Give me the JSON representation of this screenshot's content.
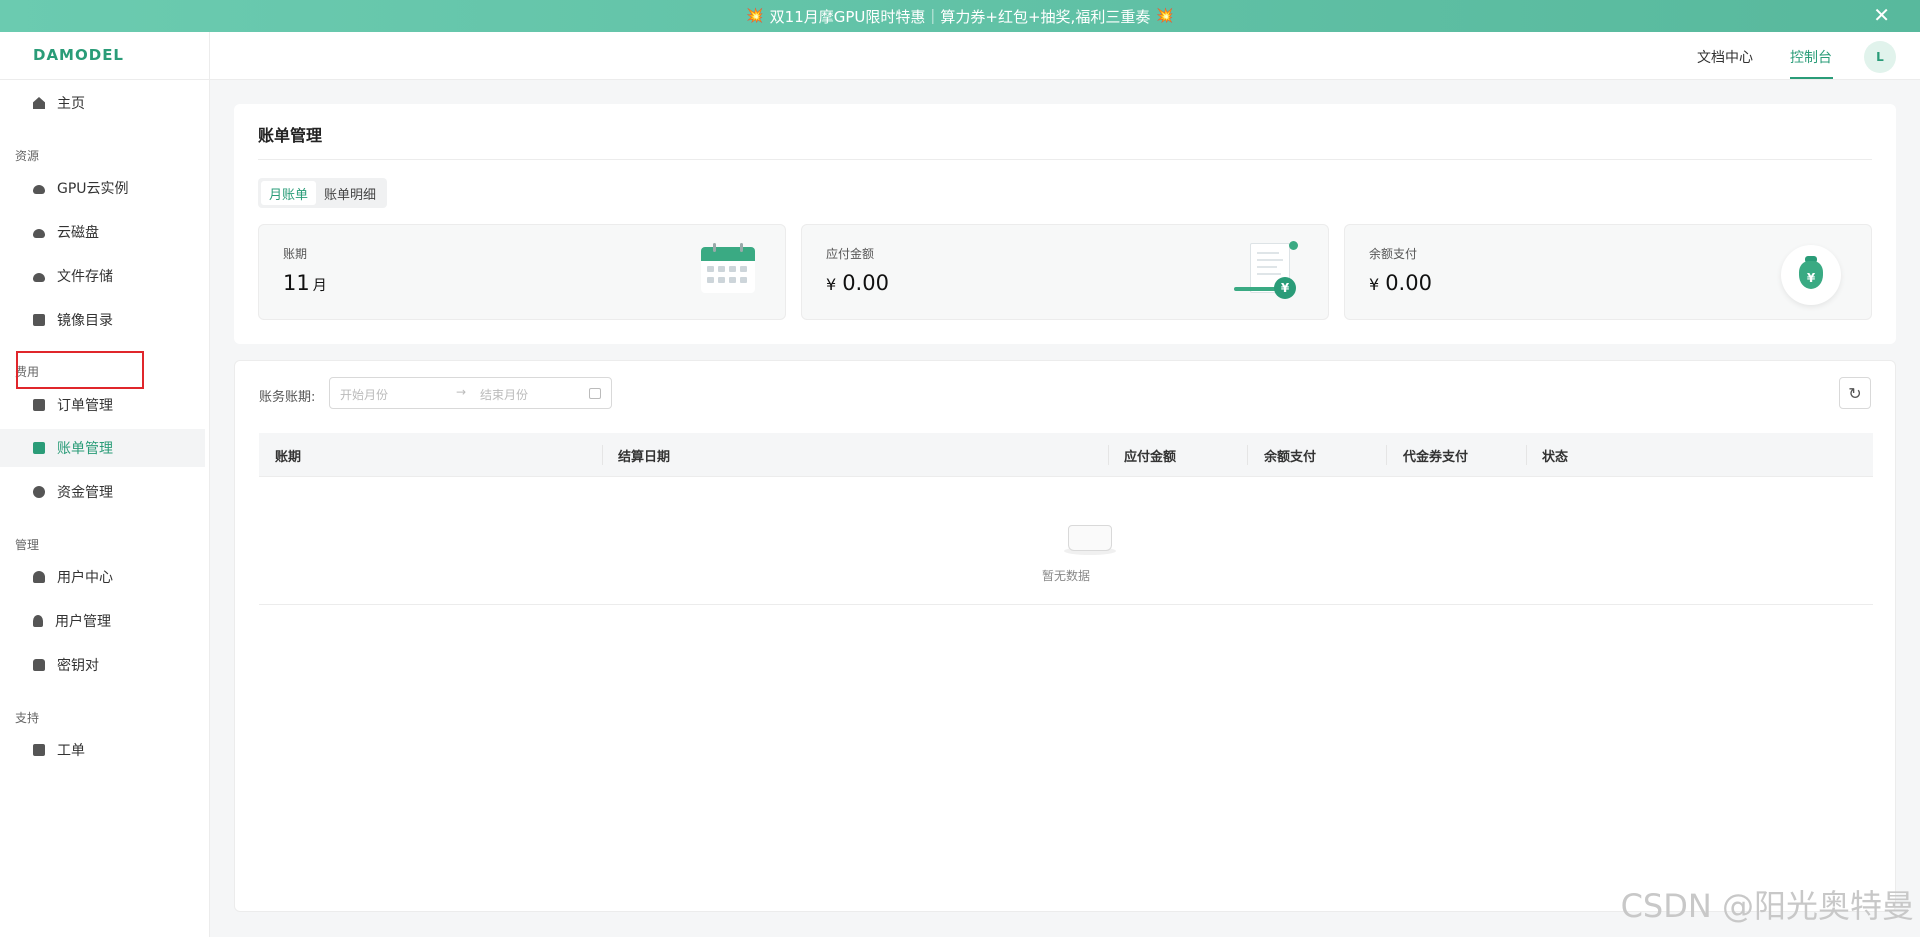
{
  "banner": {
    "text": "双11月摩GPU限时特惠｜算力券+红包+抽奖,福利三重奏",
    "left_icon": "💥",
    "right_icon": "💥",
    "close": "✕"
  },
  "header": {
    "logo": "DAMODEL",
    "docs_link": "文档中心",
    "console_link": "控制台",
    "avatar": "L"
  },
  "sidebar": {
    "home": "主页",
    "sections": {
      "resources": "资源",
      "billing": "费用",
      "management": "管理",
      "support": "支持"
    },
    "items": {
      "gpu": "GPU云实例",
      "disk": "云磁盘",
      "file_storage": "文件存储",
      "image_catalog": "镜像目录",
      "order_mgmt": "订单管理",
      "bill_mgmt": "账单管理",
      "fund_mgmt": "资金管理",
      "user_center": "用户中心",
      "user_mgmt": "用户管理",
      "key_pair": "密钥对",
      "ticket": "工单"
    }
  },
  "main": {
    "title": "账单管理",
    "tabs": [
      "月账单",
      "账单明细"
    ],
    "active_tab": 0,
    "stats": {
      "period_label": "账期",
      "period_value": "11",
      "period_unit": "月",
      "payable_label": "应付金额",
      "payable_currency": "¥",
      "payable_value": "0.00",
      "balance_label": "余额支付",
      "balance_currency": "¥",
      "balance_value": "0.00",
      "coin_symbol": "¥"
    },
    "filter": {
      "label": "账务账期:",
      "start_placeholder": "开始月份",
      "end_placeholder": "结束月份",
      "arrow": "→"
    },
    "refresh_icon": "↻",
    "table": {
      "columns": [
        "账期",
        "结算日期",
        "应付金额",
        "余额支付",
        "代金券支付",
        "状态"
      ],
      "rows": [],
      "empty_text": "暂无数据"
    }
  },
  "watermark": "CSDN @阳光奥特曼",
  "colors": {
    "brand": "#2a9c78",
    "banner": "#5fc2a6",
    "highlight": "#e0262b"
  }
}
